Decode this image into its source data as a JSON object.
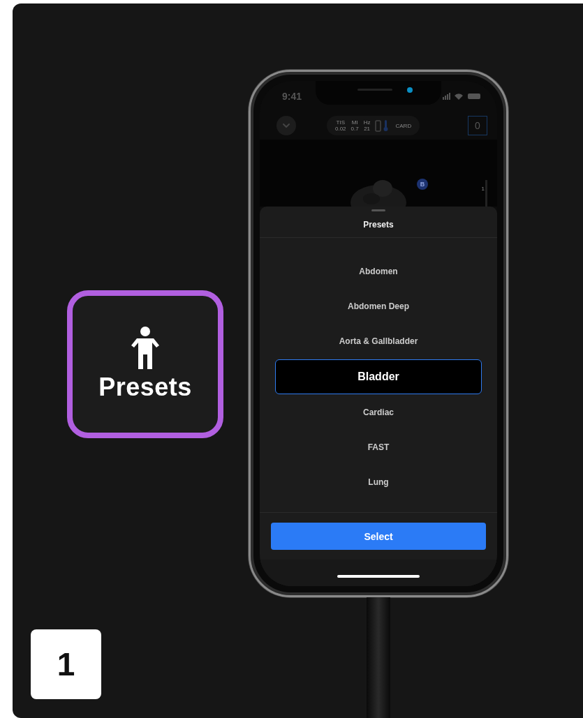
{
  "badge": {
    "label": "Presets"
  },
  "step": "1",
  "status_bar": {
    "time": "9:41"
  },
  "toolbar": {
    "readouts": [
      {
        "label": "TIS",
        "value": "0.02"
      },
      {
        "label": "MI",
        "value": "0.7"
      },
      {
        "label": "Hz",
        "value": "21"
      }
    ],
    "mode": "CARD",
    "count": "0"
  },
  "image": {
    "marker": "B",
    "scale_label": "1"
  },
  "sheet": {
    "title": "Presets",
    "items": [
      {
        "label": "Abdomen",
        "selected": false
      },
      {
        "label": "Abdomen Deep",
        "selected": false
      },
      {
        "label": "Aorta & Gallbladder",
        "selected": false
      },
      {
        "label": "Bladder",
        "selected": true
      },
      {
        "label": "Cardiac",
        "selected": false
      },
      {
        "label": "FAST",
        "selected": false
      },
      {
        "label": "Lung",
        "selected": false
      }
    ],
    "button": "Select"
  }
}
